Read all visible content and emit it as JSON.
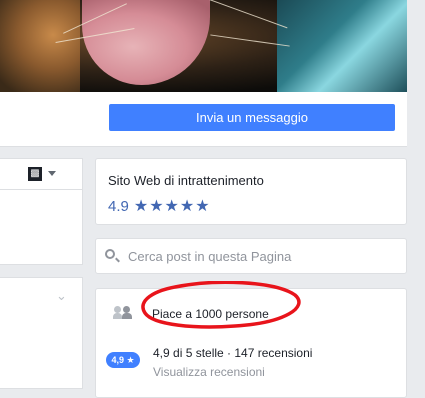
{
  "header": {
    "message_button_label": "Invia un messaggio"
  },
  "left_column": {
    "hashtag_icon": "▩",
    "caret_icon": "caret-down-icon",
    "chevron_icon": "chevron-down-icon"
  },
  "about": {
    "category": "Sito Web di intrattenimento",
    "rating_value": "4.9",
    "stars": "★★★★★"
  },
  "search": {
    "placeholder": "Cerca post in questa Pagina"
  },
  "community": {
    "likes_text": "Piace a 1000 persone",
    "rating_badge": "4,9 ★",
    "review_summary": "4,9 di 5 stelle · 147 recensioni",
    "review_link": "Visualizza recensioni",
    "annotation_color": "#e8141b"
  },
  "colors": {
    "accent": "#4080ff",
    "link": "#4267b2",
    "page_bg": "#e9ebee"
  }
}
